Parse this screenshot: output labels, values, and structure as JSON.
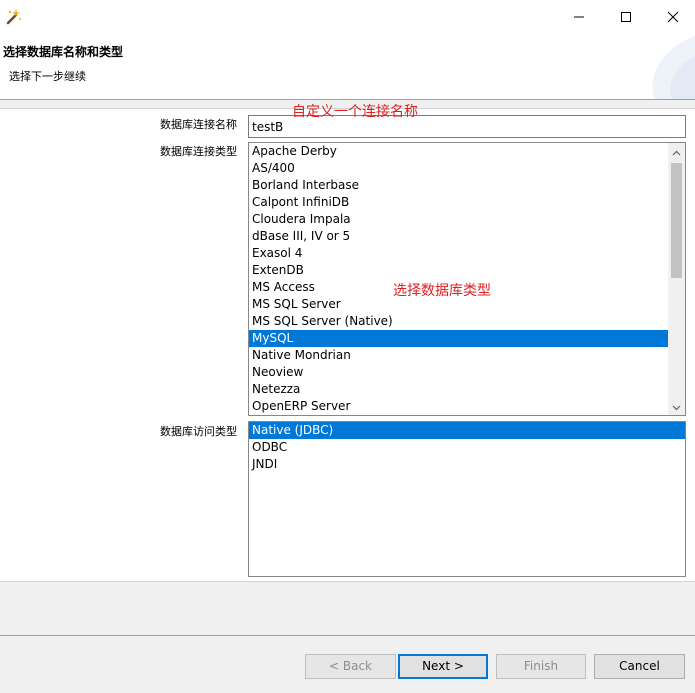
{
  "header": {
    "title": "选择数据库名称和类型",
    "subtitle": "选择下一步继续"
  },
  "form": {
    "connection_name_label": "数据库连接名称",
    "connection_name_value": "testB",
    "connection_type_label": "数据库连接类型",
    "access_type_label": "数据库访问类型",
    "annotation_name": "自定义一个连接名称",
    "annotation_type": "选择数据库类型"
  },
  "connection_types": {
    "items": [
      "Apache Derby",
      "AS/400",
      "Borland Interbase",
      "Calpont InfiniDB",
      "Cloudera Impala",
      "dBase III, IV or 5",
      "Exasol 4",
      "ExtenDB",
      "MS Access",
      "MS SQL Server",
      "MS SQL Server (Native)",
      "MySQL",
      "Native Mondrian",
      "Neoview",
      "Netezza",
      "OpenERP Server"
    ],
    "selected": "MySQL"
  },
  "access_types": {
    "items": [
      "Native (JDBC)",
      "ODBC",
      "JNDI"
    ],
    "selected": "Native (JDBC)"
  },
  "buttons": {
    "back": "< Back",
    "next": "Next >",
    "finish": "Finish",
    "cancel": "Cancel"
  },
  "icons": {
    "app": "wand-icon",
    "minimize": "minimize-icon",
    "maximize": "maximize-icon",
    "close": "close-icon"
  },
  "colors": {
    "selection": "#0078d7",
    "annotation": "#e02020"
  }
}
